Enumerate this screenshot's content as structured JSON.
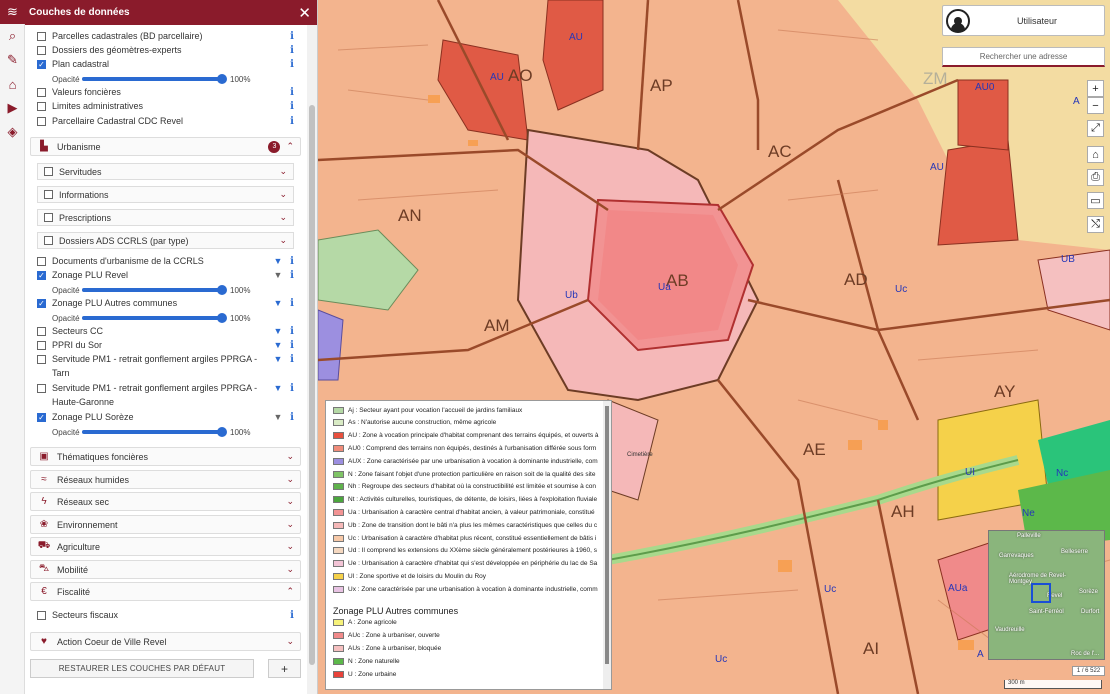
{
  "panel": {
    "title": "Couches de données",
    "close_glyph": "✕"
  },
  "toolbar": [
    {
      "icon": "layers-icon",
      "glyph": "≋"
    },
    {
      "icon": "search-icon",
      "glyph": "⌕"
    },
    {
      "icon": "draw-icon",
      "glyph": "✎"
    },
    {
      "icon": "map-area-icon",
      "glyph": "⌂"
    },
    {
      "icon": "play-icon",
      "glyph": "▶"
    },
    {
      "icon": "stack-icon",
      "glyph": "◈"
    }
  ],
  "layers_top": [
    {
      "label": "Parcelles cadastrales (BD parcellaire)",
      "checked": false
    },
    {
      "label": "Dossiers des géomètres-experts",
      "checked": false
    },
    {
      "label": "Plan cadastral",
      "checked": true
    },
    {
      "label": "Valeurs foncières",
      "checked": false
    },
    {
      "label": "Limites administratives",
      "checked": false
    },
    {
      "label": "Parcellaire Cadastral CDC Revel",
      "checked": false
    }
  ],
  "opacity_label": "Opacité",
  "opacity_value": "100%",
  "urbanisme": {
    "label": "Urbanisme",
    "badge": "3",
    "subsections": [
      "Servitudes",
      "Informations",
      "Prescriptions",
      "Dossiers ADS CCRLS (par type)"
    ],
    "layers": [
      {
        "label": "Documents d'urbanisme de la CCRLS",
        "checked": false
      },
      {
        "label": "Zonage PLU Revel",
        "checked": true
      },
      {
        "label": "Zonage PLU Autres communes",
        "checked": true
      },
      {
        "label": "Secteurs CC",
        "checked": false
      },
      {
        "label": "PPRI du Sor",
        "checked": false
      },
      {
        "label": "Servitude PM1 - retrait gonflement argiles PPRGA -",
        "label2": "Tarn",
        "checked": false
      },
      {
        "label": "Servitude PM1 - retrait gonflement argiles PPRGA -",
        "label2": "Haute-Garonne",
        "checked": false
      },
      {
        "label": "Zonage PLU Sorèze",
        "checked": true
      }
    ]
  },
  "sections": [
    {
      "label": "Thématiques foncières",
      "icon": "image-icon",
      "glyph": "▣"
    },
    {
      "label": "Réseaux humides",
      "icon": "water-icon",
      "glyph": "≈"
    },
    {
      "label": "Réseaux sec",
      "icon": "lightning-icon",
      "glyph": "ϟ"
    },
    {
      "label": "Environnement",
      "icon": "leaf-icon",
      "glyph": "❀"
    },
    {
      "label": "Agriculture",
      "icon": "tractor-icon",
      "glyph": "⛟"
    },
    {
      "label": "Mobilité",
      "icon": "car-icon",
      "glyph": "⛍"
    }
  ],
  "fiscalite": {
    "label": "Fiscalité",
    "glyph": "€",
    "layer": "Secteurs fiscaux"
  },
  "action_coeur": {
    "label": "Action Coeur de Ville Revel",
    "glyph": "♥"
  },
  "restore_button": "RESTAURER LES COUCHES PAR DÉFAUT",
  "plus_button": "+",
  "user": {
    "label": "Utilisateur"
  },
  "search": {
    "placeholder": "Rechercher une adresse"
  },
  "map_controls": [
    "+",
    "−",
    "⤢",
    "⌂",
    "⎙",
    "▭",
    "⤭"
  ],
  "map_labels": {
    "zones": [
      "AP",
      "AC",
      "ZM",
      "AN",
      "AB",
      "AD",
      "AM",
      "AY",
      "AE",
      "AH",
      "AI",
      "AO"
    ],
    "codes": [
      "AU",
      "AU",
      "AU0",
      "AU",
      "A",
      "UB",
      "Ua",
      "Ub",
      "Uc",
      "UI",
      "Ne",
      "Nc",
      "AUa",
      "Uc",
      "A",
      "Uc",
      "Cimetière"
    ]
  },
  "legend": {
    "items": [
      {
        "label": "Aj : Secteur ayant pour vocation l'accueil de jardins familiaux",
        "color": "#b5d9a6"
      },
      {
        "label": "As : N'autorise aucune construction, même agricole",
        "color": "#d9ebc5"
      },
      {
        "label": "AU : Zone à vocation principale d'habitat comprenant des terrains équipés, et ouverts à",
        "color": "#e8503e"
      },
      {
        "label": "AU0 : Comprend des terrains non équipés, destinés à l'urbanisation différée sous form",
        "color": "#f08c7a"
      },
      {
        "label": "AUX : Zone caractérisée par une urbanisation à vocation à dominante industrielle, com",
        "color": "#9c8fe0"
      },
      {
        "label": "N : Zone faisant l'objet d'une protection particulière en raison soit de la qualité des site",
        "color": "#7fc466"
      },
      {
        "label": "Nh : Regroupe des secteurs d'habitat où la constructibilité est limitée et soumise à con",
        "color": "#5fb24c"
      },
      {
        "label": "Nt : Activités culturelles, touristiques, de détente, de loisirs, liées à l'exploitation fluviale",
        "color": "#4ba63d"
      },
      {
        "label": "Ua : Urbanisation à caractère central d'habitat ancien, à valeur patrimoniale, constitué",
        "color": "#f29393"
      },
      {
        "label": "Ub : Zone de transition dont le bâti n'a plus les mêmes caractéristiques que celles du c",
        "color": "#f5b8b8"
      },
      {
        "label": "Uc : Urbanisation à caractère d'habitat plus récent, constitué essentiellement de bâtis i",
        "color": "#f7c9a8"
      },
      {
        "label": "Ud : Il comprend les extensions du XXème siècle généralement postérieures à 1960, s",
        "color": "#f5d8c0"
      },
      {
        "label": "Ue : Urbanisation à caractère d'habitat qui s'est développée en périphérie du lac de Sa",
        "color": "#f3c4d6"
      },
      {
        "label": "Ul : Zone sportive et de loisirs du Moulin du Roy",
        "color": "#f5d14a"
      },
      {
        "label": "Ux : Zone caractérisée par une urbanisation à vocation à dominante industrielle, comm",
        "color": "#e8c3e3"
      }
    ],
    "title2": "Zonage PLU Autres communes",
    "items2": [
      {
        "label": "A : Zone agricole",
        "color": "#f6f27a"
      },
      {
        "label": "AUc : Zone à urbaniser, ouverte",
        "color": "#f08a8a"
      },
      {
        "label": "AUs : Zone à urbaniser, bloquée",
        "color": "#f5c0c0"
      },
      {
        "label": "N : Zone naturelle",
        "color": "#5cb84a"
      },
      {
        "label": "U : Zone urbaine",
        "color": "#e8423a"
      }
    ]
  },
  "overview": {
    "places": [
      "Palleville",
      "Garrevaques",
      "Belleserre",
      "Aérodrome de Revel-Montgey",
      "Revel",
      "Sorèze",
      "Saint-Ferréol",
      "Durfort",
      "Vaudreuille",
      "Roc de l'..."
    ]
  },
  "scale": {
    "ratio": "1 / 6 522",
    "bar": "300 m"
  },
  "colors": {
    "brand": "#8a1b2b",
    "accent": "#2a6ad1"
  }
}
